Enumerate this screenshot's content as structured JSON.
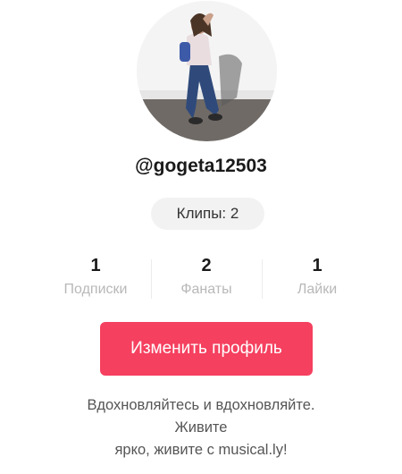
{
  "profile": {
    "username": "@gogeta12503",
    "clips_label": "Клипы: 2"
  },
  "stats": [
    {
      "value": "1",
      "label": "Подписки"
    },
    {
      "value": "2",
      "label": "Фанаты"
    },
    {
      "value": "1",
      "label": "Лайки"
    }
  ],
  "actions": {
    "edit_profile_label": "Изменить профиль"
  },
  "bio": {
    "line1": "Вдохновляйтесь и вдохновляйте.",
    "line2": "Живите",
    "line3": "ярко, живите с musical.ly!"
  },
  "colors": {
    "accent": "#f5405f",
    "stat_label": "#b8b8b8",
    "badge_bg": "#f2f2f2"
  }
}
